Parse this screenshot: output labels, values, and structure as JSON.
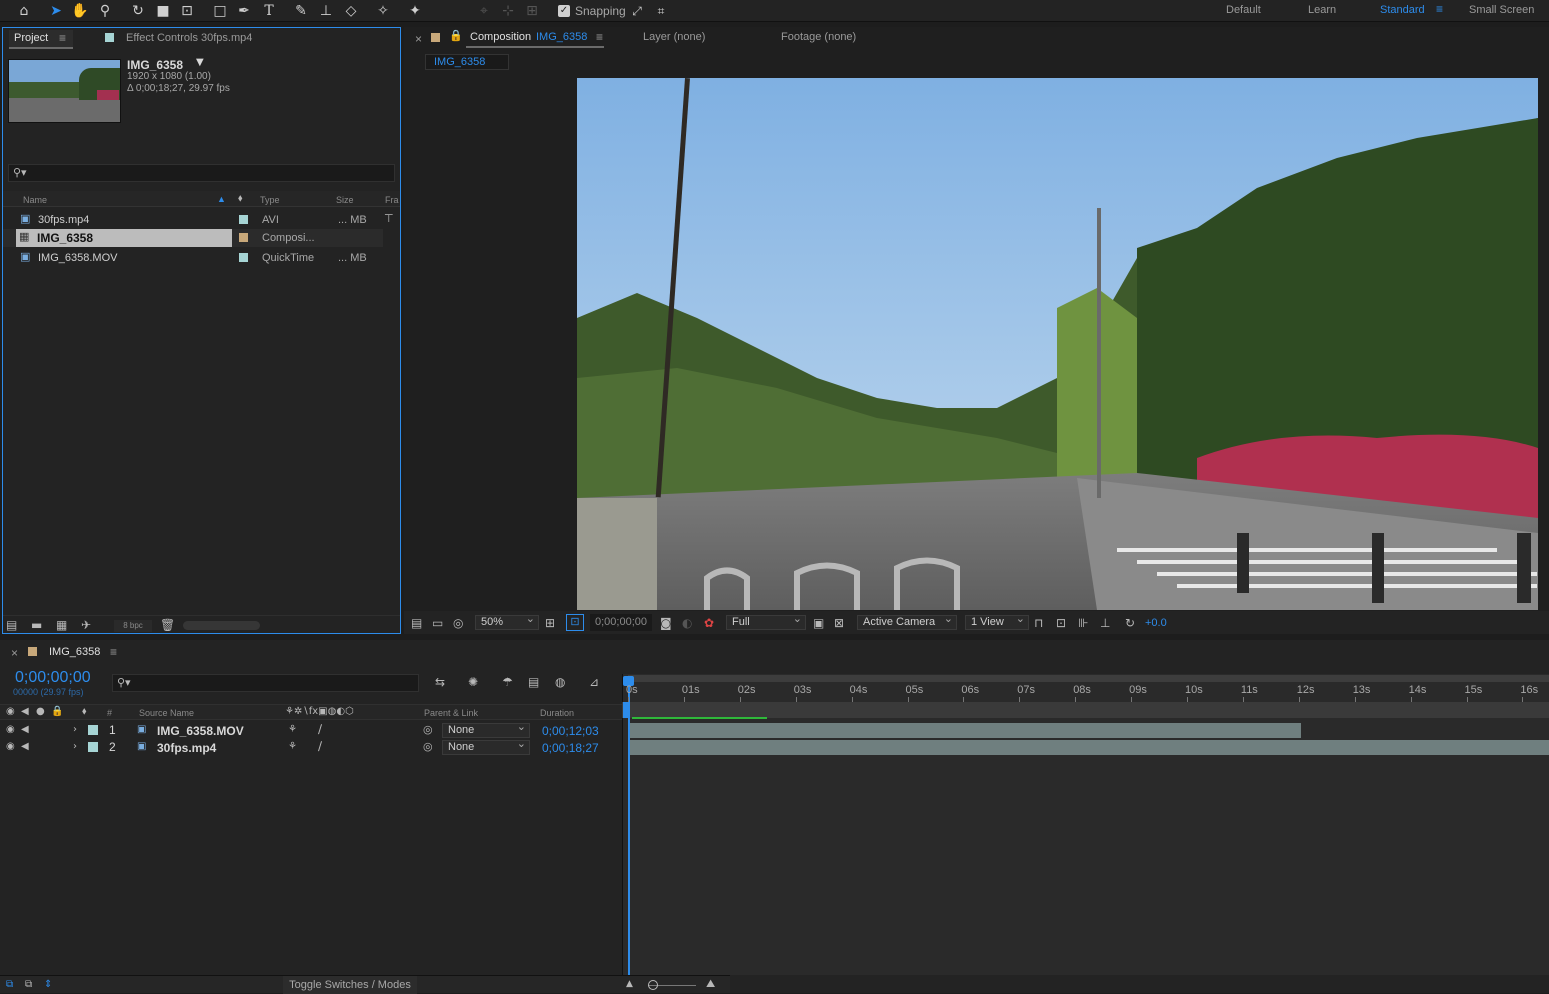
{
  "toolbar": {
    "snapping_label": "Snapping",
    "snapping_checked": true
  },
  "workspaces": {
    "items": [
      "Default",
      "Learn",
      "Standard",
      "Small Screen"
    ],
    "active": "Standard"
  },
  "project_panel": {
    "tab_project": "Project",
    "tab_effect_controls": "Effect Controls 30fps.mp4",
    "selected_name": "IMG_6358",
    "selected_dims": "1920 x 1080 (1.00)",
    "selected_duration": "Δ 0;00;18;27, 29.97 fps",
    "columns": {
      "name": "Name",
      "type": "Type",
      "size": "Size",
      "frame": "Fra"
    },
    "items": [
      {
        "name": "30fps.mp4",
        "type": "AVI",
        "size": "... MB",
        "label_color": "#a6d4d4"
      },
      {
        "name": "IMG_6358",
        "type": "Composi...",
        "size": "",
        "label_color": "#c8a87a"
      },
      {
        "name": "IMG_6358.MOV",
        "type": "QuickTime",
        "size": "... MB",
        "label_color": "#a6d4d4"
      }
    ],
    "bpc": "8 bpc"
  },
  "comp_panel": {
    "tab_comp_prefix": "Composition",
    "tab_comp_name": "IMG_6358",
    "tab_layer": "Layer (none)",
    "tab_footage": "Footage (none)",
    "breadcrumb": "IMG_6358",
    "zoom": "50%",
    "timecode": "0;00;00;00",
    "resolution": "Full",
    "camera": "Active Camera",
    "views": "1 View",
    "exposure": "+0.0"
  },
  "timeline": {
    "tab_name": "IMG_6358",
    "current_time": "0;00;00;00",
    "frame_info": "00000 (29.97 fps)",
    "col_source": "Source Name",
    "col_parent": "Parent & Link",
    "col_duration": "Duration",
    "ruler_labels": [
      "0s",
      "01s",
      "02s",
      "03s",
      "04s",
      "05s",
      "06s",
      "07s",
      "08s",
      "09s",
      "10s",
      "11s",
      "12s",
      "13s",
      "14s",
      "15s",
      "16s"
    ],
    "layers": [
      {
        "index": "1",
        "name": "IMG_6358.MOV",
        "parent": "None",
        "duration": "0;00;12;03",
        "bar_fraction": 0.73
      },
      {
        "index": "2",
        "name": "30fps.mp4",
        "parent": "None",
        "duration": "0;00;18;27",
        "bar_fraction": 1.0
      }
    ],
    "toggle_label": "Toggle Switches / Modes"
  }
}
